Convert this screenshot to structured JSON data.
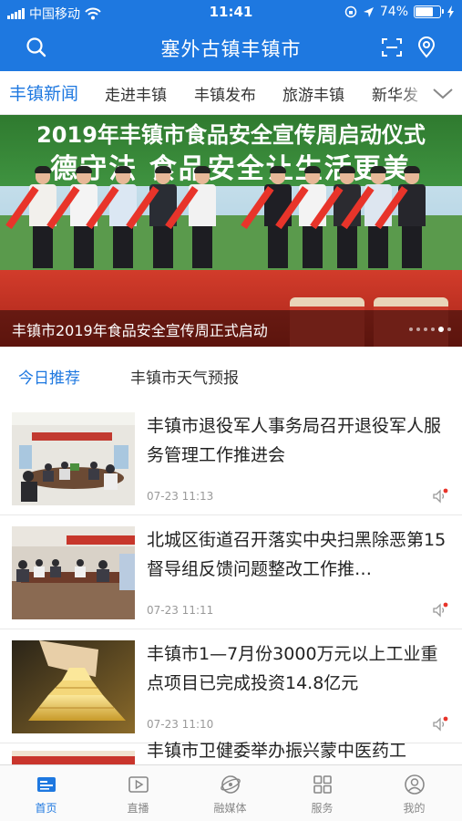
{
  "status_bar": {
    "carrier": "中国移动",
    "time": "11:41",
    "battery": "74%",
    "battery_level": 0.74
  },
  "header": {
    "title": "塞外古镇丰镇市",
    "icons": [
      "search-icon",
      "scan-icon",
      "location-icon"
    ]
  },
  "categories": {
    "items": [
      {
        "label": "丰镇新闻",
        "active": true
      },
      {
        "label": "走进丰镇"
      },
      {
        "label": "丰镇发布"
      },
      {
        "label": "旅游丰镇"
      },
      {
        "label": "新华发"
      }
    ],
    "more_icon": "chevron-down-icon"
  },
  "banner": {
    "image_text_line1": "2019年丰镇市食品安全宣传周启动仪式",
    "image_text_line2": "德守法  食品安全让生活更美",
    "caption": "丰镇市2019年食品安全宣传周正式启动",
    "slide_count": 6,
    "active_slide": 5
  },
  "sub_tabs": [
    {
      "label": "今日推荐",
      "active": true
    },
    {
      "label": "丰镇市天气预报"
    }
  ],
  "news": [
    {
      "title": "丰镇市退役军人事务局召开退役军人服务管理工作推进会",
      "time": "07-23 11:13",
      "thumb": "meeting-room"
    },
    {
      "title": "北城区街道召开落实中央扫黑除恶第15督导组反馈问题整改工作推…",
      "time": "07-23 11:11",
      "thumb": "conference"
    },
    {
      "title": "丰镇市1—7月份3000万元以上工业重点项目已完成投资14.8亿元",
      "time": "07-23 11:10",
      "thumb": "gold-bars"
    },
    {
      "title": "丰镇市卫健委举办振兴蒙中医药工",
      "time": "",
      "thumb": "banner-photo"
    }
  ],
  "tabbar": [
    {
      "label": "首页",
      "icon": "home-news-icon",
      "active": true
    },
    {
      "label": "直播",
      "icon": "video-play-icon"
    },
    {
      "label": "融媒体",
      "icon": "media-globe-icon"
    },
    {
      "label": "服务",
      "icon": "grid-apps-icon"
    },
    {
      "label": "我的",
      "icon": "user-profile-icon"
    }
  ],
  "colors": {
    "brand_blue": "#1e78e0",
    "banner_red": "#d23c2b",
    "tab_inactive": "#888888"
  }
}
